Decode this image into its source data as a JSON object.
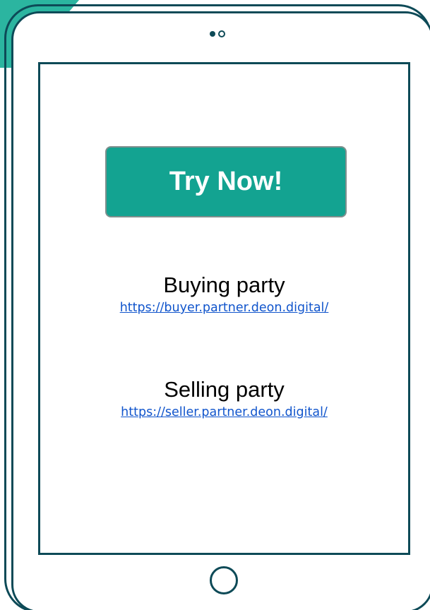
{
  "cta": {
    "label": "Try Now!"
  },
  "parties": [
    {
      "title": "Buying party",
      "url": "https://buyer.partner.deon.digital/"
    },
    {
      "title": "Selling party",
      "url": "https://seller.partner.deon.digital/"
    }
  ],
  "colors": {
    "accent": "#2bb5a0",
    "button": "#13a391",
    "frame": "#0d4a57",
    "link": "#1155cc"
  },
  "icons": {
    "camera": "camera-icon",
    "home": "home-button-icon"
  }
}
